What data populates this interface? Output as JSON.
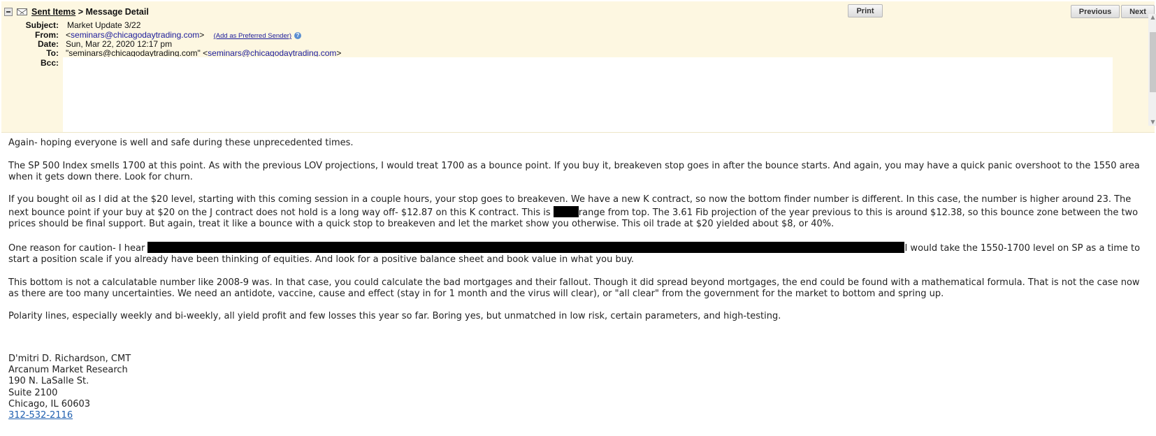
{
  "header": {
    "breadcrumb_link": "Sent Items",
    "breadcrumb_sep": " > ",
    "breadcrumb_current": "Message Detail",
    "print_label": "Print",
    "previous_label": "Previous",
    "next_label": "Next"
  },
  "fields": {
    "subject_label": "Subject:",
    "subject_value": "Market Update 3/22",
    "from_label": "From:",
    "from_open": "<",
    "from_email": "seminars@chicagodaytrading.com",
    "from_close": ">",
    "add_preferred": "(Add as Preferred Sender)",
    "date_label": "Date:",
    "date_value": "Sun, Mar 22, 2020 12:17 pm",
    "to_label": "To:",
    "to_name": "\"seminars@chicagodaytrading.com\" <",
    "to_email": "seminars@chicagodaytrading.com",
    "to_close": ">",
    "bcc_label": "Bcc:"
  },
  "body": {
    "p1": "Again- hoping everyone is well and safe during these unprecedented times.",
    "p2": "The SP 500 Index smells 1700 at this point. As with the previous LOV projections, I would treat 1700 as a bounce point. If you buy it, breakeven stop goes in after the bounce starts. And again, you may have a quick panic overshoot to the 1550 area when it gets down there. Look for churn.",
    "p3_before": "If you bought oil as I did at the $20 level, starting with this coming session in a couple hours, your stop goes to breakeven. We have a new K contract, so now the bottom finder number is different. In this case, the number is higher around 23. The next bounce point if your buy at $20 on the J contract does not hold is a long way off- $12.87 on this K contract. This is ",
    "p3_after": "range from top. The 3.61 Fib projection of the year previous to this is around $12.38, so this bounce zone between the two prices should be final support. But again, treat it like a bounce with a quick stop to breakeven and let the market show you otherwise. This oil trade at $20 yielded about $8, or 40%.",
    "p4_before": "One reason for caution- I hear ",
    "p4_after": "I would take the 1550-1700 level on SP as a time to start a position scale if you already have been thinking of equities. And look for a positive balance sheet and book value in what you buy.",
    "p5": "This bottom is not a calculatable number like 2008-9 was. In that case, you could calculate the bad mortgages and their fallout. Though it did spread beyond mortgages, the end could be found with a mathematical formula. That is not the case now as there are too many uncertainties. We need an antidote, vaccine, cause and effect (stay in for 1 month and the virus will clear), or \"all clear\" from the government for the market to bottom and spring up.",
    "p6": "Polarity lines, especially weekly and bi-weekly, all yield profit and few losses this year so far. Boring yes, but unmatched in low risk, certain parameters, and high-testing."
  },
  "signature": {
    "name": "D'mitri D. Richardson, CMT",
    "company": "Arcanum Market Research",
    "street": "190 N. LaSalle St.",
    "suite": "Suite 2100",
    "city": "Chicago, IL 60603",
    "phone": "312-532-2116"
  },
  "icons": [
    "collapse-icon",
    "envelope-icon",
    "help-icon",
    "scroll-up-icon",
    "scroll-down-icon"
  ],
  "colors": {
    "header_bg": "#fdf7e1",
    "link": "#1a1a9a",
    "phone_link": "#2060b0",
    "redaction": "#000000"
  }
}
